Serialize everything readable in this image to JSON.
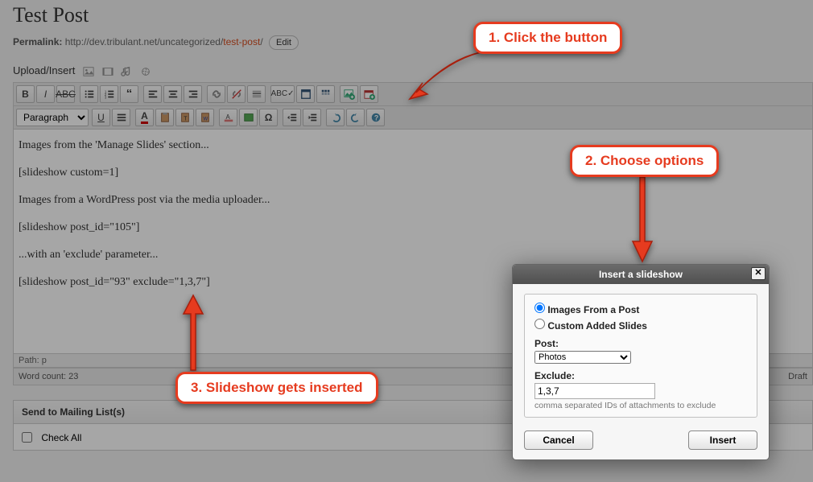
{
  "post": {
    "title": "Test Post",
    "permalink_label": "Permalink:",
    "permalink_base": "http://dev.tribulant.net/uncategorized/",
    "permalink_slug": "test-post",
    "permalink_suffix": "/",
    "edit_btn": "Edit"
  },
  "upload_label": "Upload/Insert",
  "toolbar2_paragraph": "Paragraph",
  "content": {
    "l1": "Images from the 'Manage Slides' section...",
    "l2": "[slideshow custom=1]",
    "l3": "Images from a WordPress post via the media uploader...",
    "l4": "[slideshow post_id=\"105\"]",
    "l5": "...with an 'exclude' parameter...",
    "l6": "[slideshow post_id=\"93\" exclude=\"1,3,7\"]"
  },
  "status": {
    "path_label": "Path:",
    "path_value": "p",
    "word_count_label": "Word count:",
    "word_count_value": "23",
    "draft_label": "Draft"
  },
  "metabox": {
    "title": "Send to Mailing List(s)",
    "check_all": "Check All"
  },
  "dialog": {
    "title": "Insert a slideshow",
    "opt1": "Images From a Post",
    "opt2": "Custom Added Slides",
    "post_label": "Post:",
    "post_value": "Photos",
    "exclude_label": "Exclude:",
    "exclude_value": "1,3,7",
    "exclude_hint": "comma separated IDs of attachments to exclude",
    "cancel": "Cancel",
    "insert": "Insert"
  },
  "annotations": {
    "a1": "1. Click the button",
    "a2": "2. Choose options",
    "a3": "3. Slideshow gets inserted"
  }
}
